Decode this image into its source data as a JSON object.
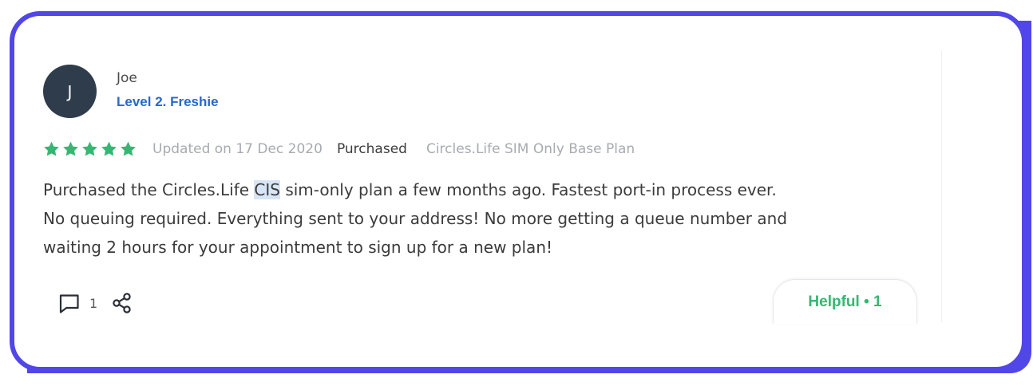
{
  "colors": {
    "frame": "#5147e8",
    "avatar_bg": "#2f3c4b",
    "level": "#2b67c8",
    "star": "#35b773",
    "helpful": "#35b773",
    "muted": "#a7abb0",
    "highlight": "#d8e5f6"
  },
  "reviewer": {
    "initial": "J",
    "name": "Joe",
    "level": "Level 2. Freshie"
  },
  "rating": {
    "stars": 5,
    "max_stars": 5,
    "updated": "Updated on 17 Dec 2020",
    "status": "Purchased",
    "product": "Circles.Life SIM Only Base Plan"
  },
  "review": {
    "line1_before": "Purchased the Circles.Life ",
    "line1_highlight": "CIS",
    "line1_after": " sim-only plan a few months ago. Fastest port-in process ever.",
    "line2": "No queuing required. Everything sent to your address! No more getting a queue number and",
    "line3": "waiting 2 hours for your appointment to sign up for a new plan!"
  },
  "actions": {
    "comment_icon": "comment-icon",
    "comment_count": "1",
    "share_icon": "share-icon",
    "helpful_label": "Helpful • 1"
  }
}
